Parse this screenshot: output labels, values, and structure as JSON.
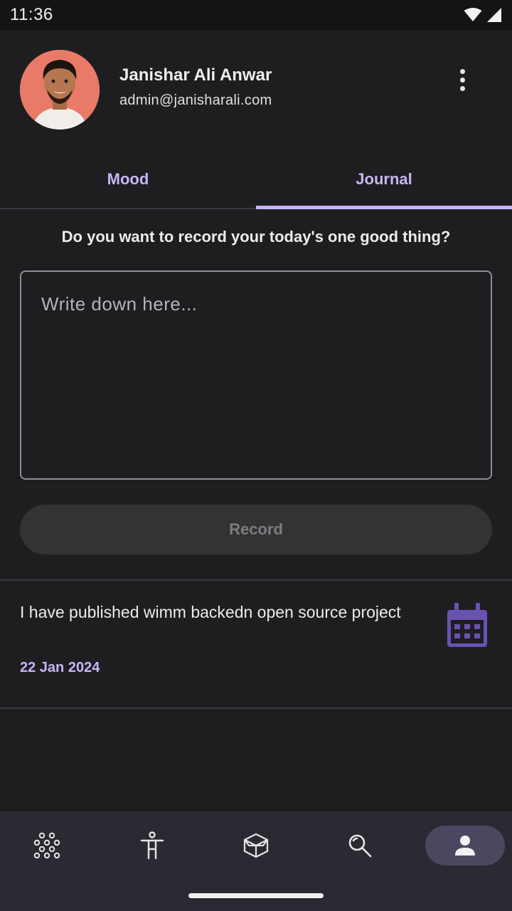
{
  "status_bar": {
    "time": "11:36"
  },
  "profile": {
    "name": "Janishar Ali Anwar",
    "email": "admin@janisharali.com"
  },
  "tabs": [
    {
      "label": "Mood",
      "active": false
    },
    {
      "label": "Journal",
      "active": true
    }
  ],
  "journal": {
    "prompt": "Do you want to record your today's one good thing?",
    "input_placeholder": "Write down here...",
    "input_value": "",
    "record_label": "Record",
    "entries": [
      {
        "text": "I have published wimm backedn open source project",
        "date": "22 Jan 2024",
        "icon": "calendar-icon"
      }
    ]
  },
  "bottom_nav": [
    {
      "name": "explore",
      "icon": "dots-grid-icon",
      "active": false
    },
    {
      "name": "mindfulness",
      "icon": "person-standing-icon",
      "active": false
    },
    {
      "name": "library",
      "icon": "box-icon",
      "active": false
    },
    {
      "name": "search",
      "icon": "search-icon",
      "active": false
    },
    {
      "name": "profile",
      "icon": "person-icon",
      "active": true
    }
  ],
  "colors": {
    "background": "#1e1e21",
    "accent": "#c8b5f5",
    "calendar_icon": "#6a52b0",
    "nav_background": "#2a2a33",
    "nav_active_pill": "#4a4860"
  }
}
